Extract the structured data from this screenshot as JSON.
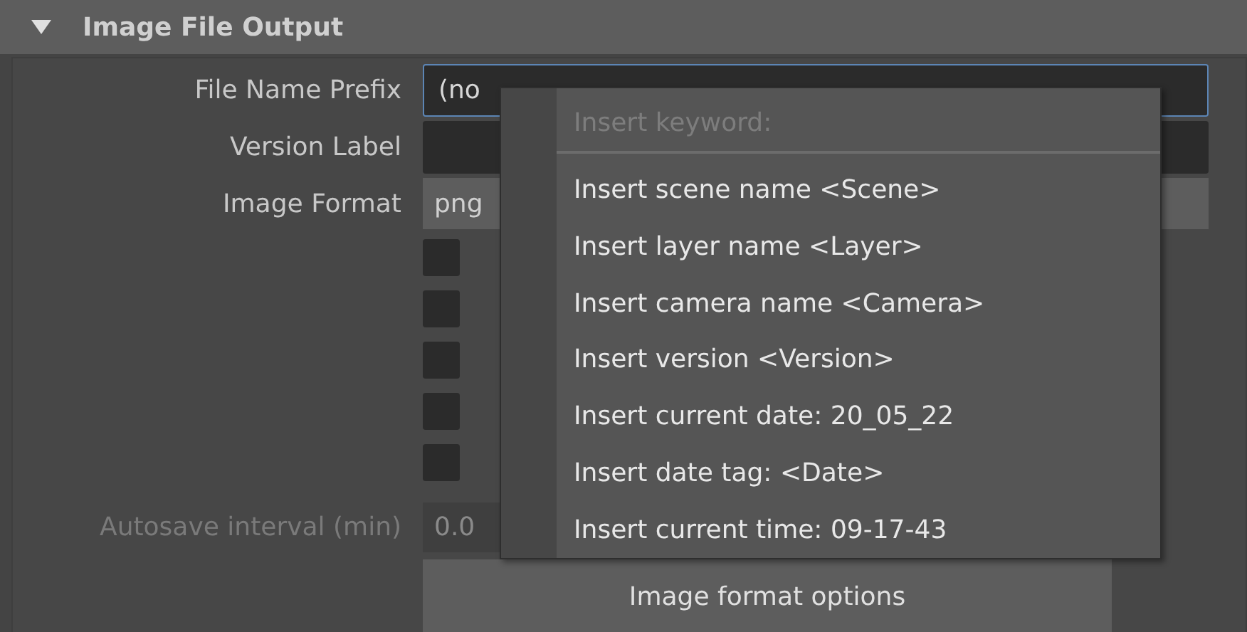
{
  "section": {
    "title": "Image File Output",
    "expanded": true
  },
  "fields": [
    {
      "kind": "text",
      "label": "File Name Prefix",
      "value": "(no",
      "focused": true
    },
    {
      "kind": "text",
      "label": "Version Label",
      "focused": false
    },
    {
      "kind": "dropdown",
      "label": "Image Format",
      "value": "png"
    }
  ],
  "checkboxes": [
    {
      "checked": false
    },
    {
      "checked": false
    },
    {
      "checked": false
    },
    {
      "checked": false
    },
    {
      "checked": false
    }
  ],
  "autosave": {
    "label": "Autosave interval (min)",
    "value": "0.0",
    "disabled": true
  },
  "button": {
    "label": "Image format options"
  },
  "menu": {
    "header": "Insert keyword:",
    "items": [
      {
        "label": "Insert scene name <Scene>"
      },
      {
        "label": "Insert layer name <Layer>"
      },
      {
        "label": "Insert camera name <Camera>"
      },
      {
        "label": "Insert version <Version>"
      },
      {
        "label": "Insert current date: 20_05_22"
      },
      {
        "label": "Insert date tag: <Date>"
      },
      {
        "label": "Insert current time: 09-17-43"
      }
    ]
  }
}
